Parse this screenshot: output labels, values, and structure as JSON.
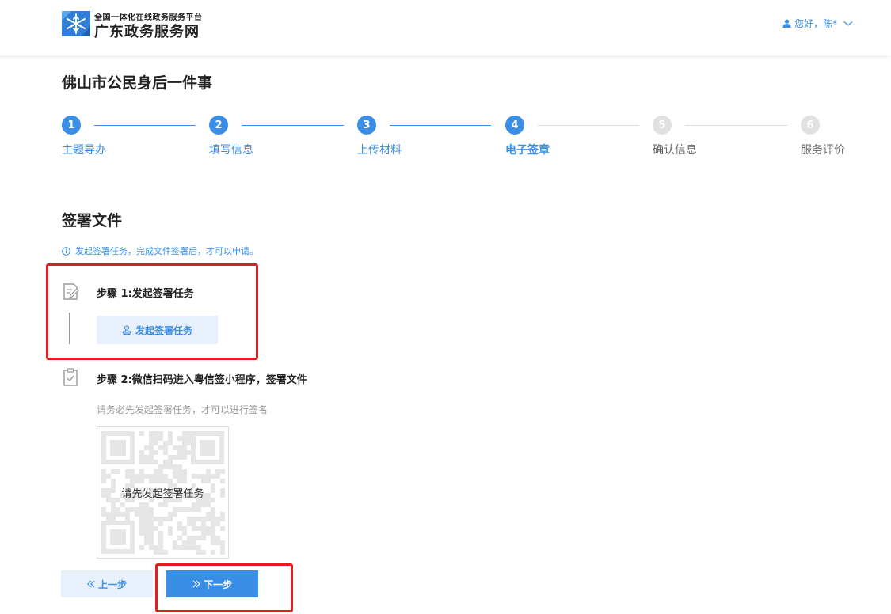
{
  "header": {
    "brand_sub": "全国一体化在线政务服务平台",
    "brand_main": "广东政务服务网",
    "user_greeting": "您好，陈*",
    "accent": "#3a8ee6"
  },
  "page": {
    "title": "佛山市公民身后一件事"
  },
  "steps": [
    {
      "num": "1",
      "label": "主题导办",
      "state": "done"
    },
    {
      "num": "2",
      "label": "填写信息",
      "state": "done"
    },
    {
      "num": "3",
      "label": "上传材料",
      "state": "done"
    },
    {
      "num": "4",
      "label": "电子签章",
      "state": "current"
    },
    {
      "num": "5",
      "label": "确认信息",
      "state": "todo"
    },
    {
      "num": "6",
      "label": "服务评价",
      "state": "todo"
    }
  ],
  "sign": {
    "section_title": "签署文件",
    "tip": "发起签署任务，完成文件签署后，才可以申请。",
    "step1_title": "步骤 1:发起签署任务",
    "step1_button": "发起签署任务",
    "step2_title": "步骤 2:微信扫码进入粤信签小程序，签署文件",
    "step2_hint": "请务必先发起签署任务，才可以进行签名",
    "qr_overlay": "请先发起签署任务"
  },
  "actions": {
    "prev_label": "上一步",
    "next_label": "下一步"
  },
  "icons": {
    "logo": "snowflake-logo-icon",
    "user": "user-icon",
    "chevron": "chevron-down-icon",
    "info": "info-circle-icon",
    "edit": "edit-document-icon",
    "clipboard": "clipboard-check-icon",
    "stamp": "stamp-icon",
    "prev": "double-chevron-left-icon",
    "next": "double-chevron-right-icon"
  }
}
